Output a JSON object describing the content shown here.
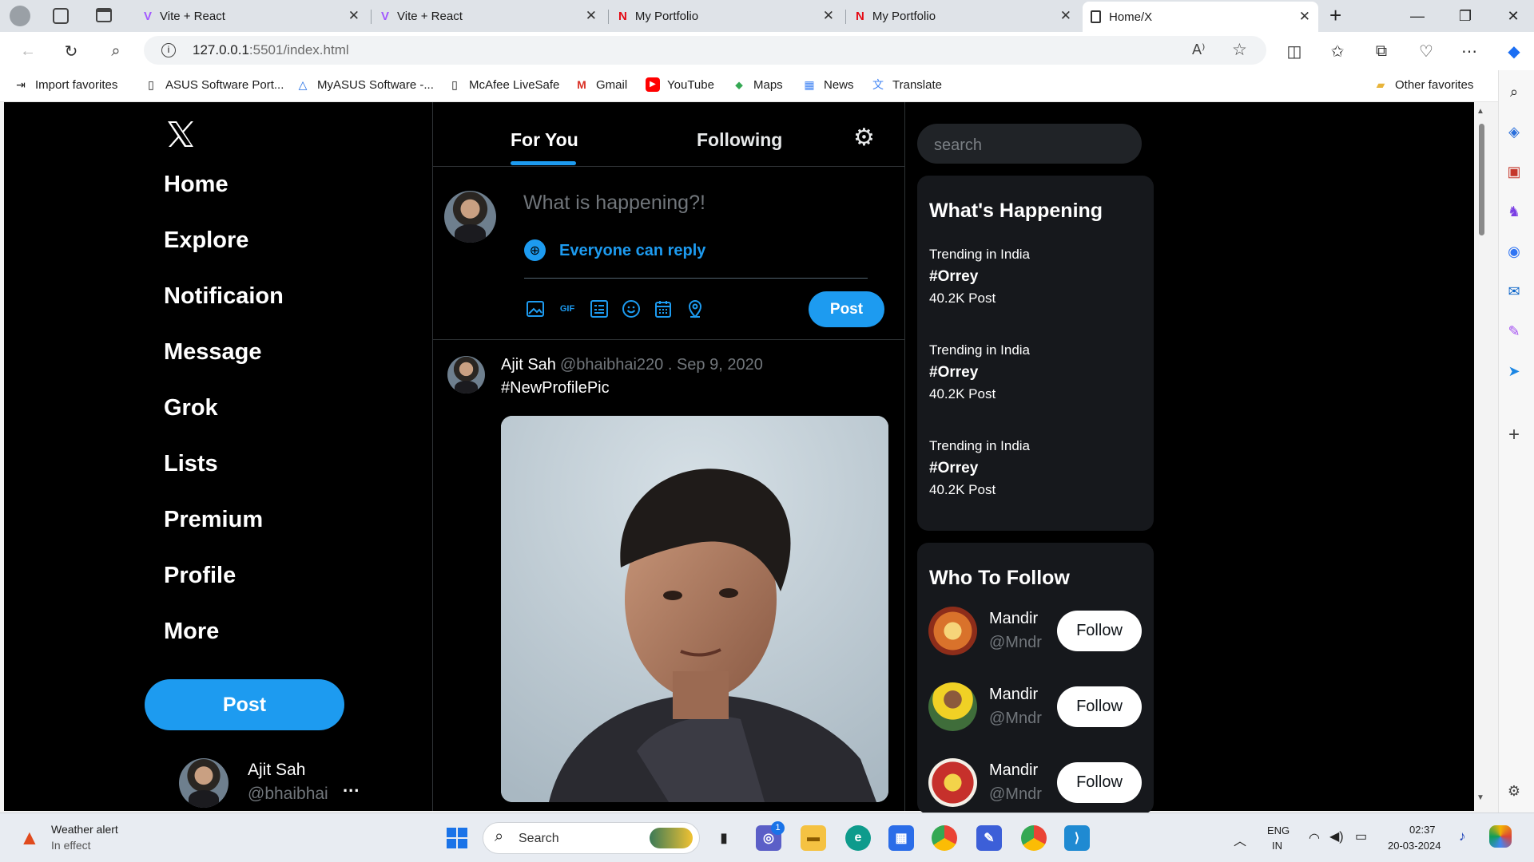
{
  "browser": {
    "tabs": [
      {
        "label": "Vite + React",
        "active": false
      },
      {
        "label": "Vite + React",
        "active": false
      },
      {
        "label": "My Portfolio",
        "active": false
      },
      {
        "label": "My Portfolio",
        "active": false
      },
      {
        "label": "Home/X",
        "active": true
      }
    ],
    "url_host": "127.0.0.1",
    "url_path": ":5501/index.html",
    "favorites": [
      {
        "label": "Import favorites",
        "icon": "import-icon"
      },
      {
        "label": "ASUS Software Port...",
        "icon": "page-icon"
      },
      {
        "label": "MyASUS Software -...",
        "icon": "asus-icon"
      },
      {
        "label": "McAfee LiveSafe",
        "icon": "page-icon"
      },
      {
        "label": "Gmail",
        "icon": "gmail-icon"
      },
      {
        "label": "YouTube",
        "icon": "youtube-icon"
      },
      {
        "label": "Maps",
        "icon": "maps-icon"
      },
      {
        "label": "News",
        "icon": "news-icon"
      },
      {
        "label": "Translate",
        "icon": "translate-icon"
      }
    ],
    "other_favorites": "Other favorites"
  },
  "x": {
    "logo": "X",
    "nav": [
      "Home",
      "Explore",
      "Notificaion",
      "Message",
      "Grok",
      "Lists",
      "Premium",
      "Profile",
      "More"
    ],
    "post_button": "Post",
    "user": {
      "name": "Ajit Sah",
      "handle": "@bhaibhai",
      "more": "..."
    },
    "tabs": {
      "for_you": "For You",
      "following": "Following"
    },
    "composer": {
      "placeholder": "What is happening?!",
      "reply_setting": "Everyone can reply",
      "post": "Post"
    },
    "tweet": {
      "name": "Ajit Sah",
      "meta": "@bhaibhai220 . Sep 9, 2020",
      "text": "#NewProfilePic"
    },
    "search_placeholder": "search",
    "happening": {
      "title": "What's Happening",
      "items": [
        {
          "context": "Trending in India",
          "tag": "#Orrey",
          "count": "40.2K Post"
        },
        {
          "context": "Trending in India",
          "tag": "#Orrey",
          "count": "40.2K Post"
        },
        {
          "context": "Trending in India",
          "tag": "#Orrey",
          "count": "40.2K Post"
        }
      ]
    },
    "who_to_follow": {
      "title": "Who To Follow",
      "items": [
        {
          "name": "Mandir",
          "handle": "@Mndr",
          "button": "Follow"
        },
        {
          "name": "Mandir",
          "handle": "@Mndr",
          "button": "Follow"
        },
        {
          "name": "Mandir",
          "handle": "@Mndr",
          "button": "Follow"
        }
      ]
    }
  },
  "taskbar": {
    "weather_title": "Weather alert",
    "weather_sub": "In effect",
    "search": "Search",
    "chat_badge": "1",
    "lang1": "ENG",
    "lang2": "IN",
    "time": "02:37",
    "date": "20-03-2024"
  },
  "colors": {
    "accent": "#1d9bf0",
    "bg": "#000000",
    "card": "#16181c"
  }
}
